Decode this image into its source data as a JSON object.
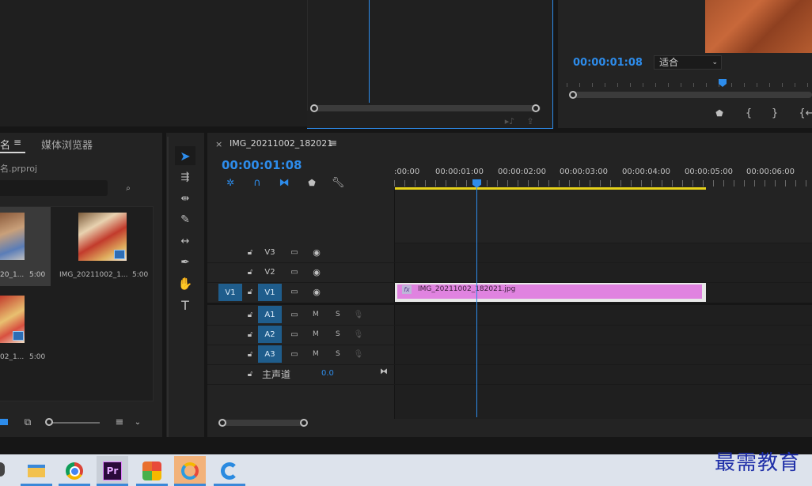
{
  "program_monitor": {
    "timecode": "00:00:01:08",
    "zoom_select": "适合",
    "zoom_options": [
      "适合"
    ]
  },
  "project_panel": {
    "tab_name_partial": "名",
    "tab_media_browser": "媒体浏览器",
    "project_file": "名.prproj",
    "items": [
      {
        "name": "20_1...",
        "duration": "5:00"
      },
      {
        "name": "IMG_20211002_1...",
        "duration": "5:00"
      },
      {
        "name": "02_1...",
        "duration": "5:00"
      }
    ]
  },
  "timeline": {
    "tab_title": "IMG_20211002_182021",
    "timecode": "00:00:01:08",
    "ruler_labels": [
      ":00:00",
      "00:00:01:00",
      "00:00:02:00",
      "00:00:03:00",
      "00:00:04:00",
      "00:00:05:00",
      "00:00:06:00"
    ],
    "clip_name": "IMG_20211002_182021.jpg",
    "clip_fx": "fx",
    "video_tracks": [
      {
        "label": "V3",
        "source": ""
      },
      {
        "label": "V2",
        "source": ""
      },
      {
        "label": "V1",
        "source": "V1"
      }
    ],
    "audio_tracks": [
      {
        "label": "A1",
        "m": "M",
        "s": "S"
      },
      {
        "label": "A2",
        "m": "M",
        "s": "S"
      },
      {
        "label": "A3",
        "m": "M",
        "s": "S"
      }
    ],
    "master": {
      "label": "主声道",
      "value": "0.0"
    }
  },
  "taskbar": {
    "watermark": "最需教育",
    "premiere_label": "Pr"
  },
  "colors": {
    "accent": "#2d8ceb",
    "clip": "#e083e0",
    "work_area": "#e6d21a",
    "track_target": "#1f5d8c"
  }
}
